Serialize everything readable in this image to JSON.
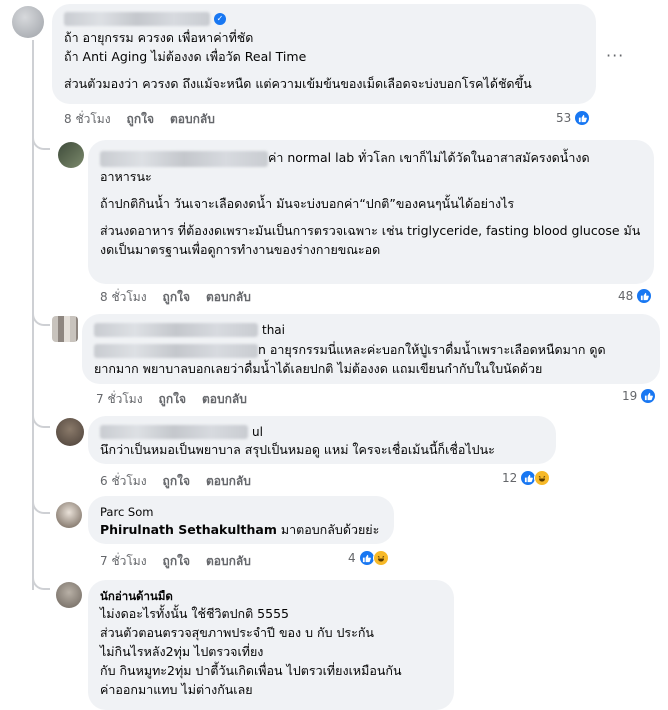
{
  "comments": [
    {
      "author_blurred": true,
      "verified": true,
      "paragraphs": [
        "ถ้า อายุกรรม ควรงด เพื่อหาค่าที่ชัด",
        "ถ้า Anti Aging ไม่ต้องงด เพื่อวัด Real Time",
        "ส่วนตัวมองว่า ควรงด ถึงแม้จะหนืด แต่ความเข้มข้นของเม็ดเลือดจะบ่งบอกโรคได้ชัดขึ้น"
      ],
      "time": "8 ชั่วโมง",
      "like": "ถูกใจ",
      "reply": "ตอบกลับ",
      "reactions": "53",
      "more": "···"
    },
    {
      "author_blurred": true,
      "line1_suffix": "ค่า normal lab ทั่วโลก เขาก็ไม่ได้วัดในอาสาสมัครงดน้ำงด",
      "line1_cont": "อาหารนะ",
      "paragraphs": [
        "ถ้าปกติกินน้ำ วันเจาะเลือดงดน้ำ มันจะบ่งบอกค่า“ปกติ”ของคนๆนั้นได้อย่างไร",
        "ส่วนงดอาหาร ที่ต้องงดเพราะมันเป็นการตรวจเฉพาะ เช่น triglyceride, fasting blood glucose มันงดเป็นมาตรฐานเพื่อดูการทำงานของร่างกายขณะอด"
      ],
      "time": "8 ชั่วโมง",
      "like": "ถูกใจ",
      "reply": "ตอบกลับ",
      "reactions": "48"
    },
    {
      "author_suffix": "thai",
      "line1_suffix": "n อายุรกรรมนี่แหละค่ะบอกให้ปู่เราดื่มน้ำเพราะเลือดหนืดมาก ดูด",
      "line1_cont": "ยากมาก พยาบาลบอกเลยว่าดื่มน้ำได้เลยปกติ ไม่ต้องงด แถมเขียนกำกับในใบนัดด้วย",
      "time": "7 ชั่วโมง",
      "like": "ถูกใจ",
      "reply": "ตอบกลับ",
      "reactions": "19"
    },
    {
      "author_suffix": "ul",
      "text": "นึกว่าเป็นหมอเป็นพยาบาล สรุปเป็นหมอดู แหม่ ใครจะเชื่อเม้นนี้ก็เชื่อไปนะ",
      "time": "6 ชั่วโมง",
      "like": "ถูกใจ",
      "reply": "ตอบกลับ",
      "reactions": "12"
    },
    {
      "author": "Parc Som",
      "tag": "Phirulnath Sethakultham",
      "text": " มาตอบกลับด้วยย่ะ",
      "time": "7 ชั่วโมง",
      "like": "ถูกใจ",
      "reply": "ตอบกลับ",
      "reactions": "4"
    },
    {
      "author": "นักอ่านด้านมืด",
      "lines": [
        "ไม่งดอะไรทั้งนั้น ใช้ชีวิตปกติ 5555",
        "ส่วนตัวตอนตรวจสุขภาพประจำปี ของ บ กับ ประกัน",
        "ไม่กินไรหลัง2ทุ่ม ไปตรวจเที่ยง",
        "กับ กินหมูทะ2ทุ่ม ปาตี้วันเกิดเพื่อน ไปตรวเที่ยงเหมือนกัน",
        "ค่าออกมาแทบ ไม่ต่างกันเลย"
      ]
    }
  ],
  "icons": {
    "like": "like-icon",
    "haha": "haha-icon",
    "more": "more-icon",
    "verified": "verified-icon"
  },
  "colors": {
    "bubble": "#f0f2f5",
    "link_blue": "#1877f2",
    "meta_gray": "#65676b"
  }
}
